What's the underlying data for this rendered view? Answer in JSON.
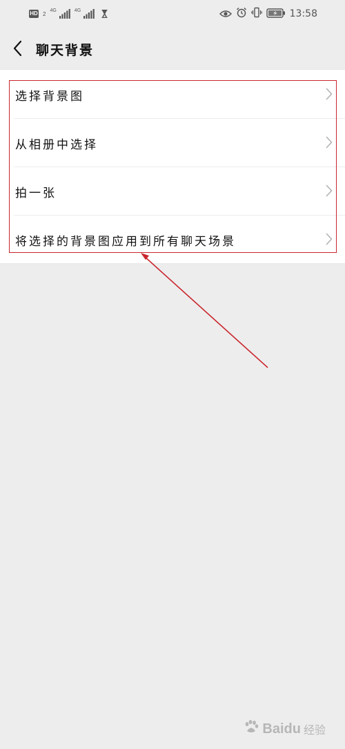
{
  "status_bar": {
    "hd": "HD",
    "sim_badge": "2",
    "net1": "4G",
    "net2": "4G",
    "time": "13:58"
  },
  "header": {
    "back_icon": "chevron-left-icon",
    "title": "聊天背景"
  },
  "menu": {
    "items": [
      {
        "label": "选择背景图"
      },
      {
        "label": "从相册中选择"
      },
      {
        "label": "拍一张"
      },
      {
        "label": "将选择的背景图应用到所有聊天场景"
      }
    ]
  },
  "annotation": {
    "color": "#c9252c"
  },
  "watermark": {
    "brand": "Baidu",
    "sub": "经验"
  }
}
